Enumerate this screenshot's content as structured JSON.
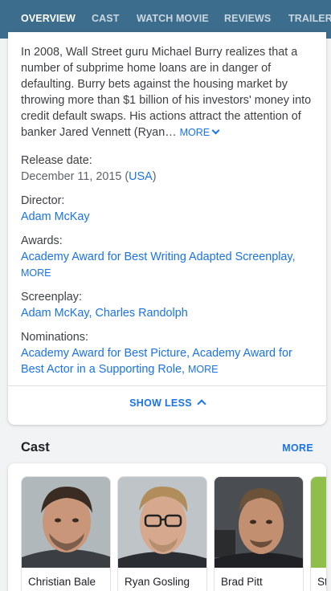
{
  "tabs": [
    {
      "label": "OVERVIEW",
      "active": true
    },
    {
      "label": "CAST",
      "active": false
    },
    {
      "label": "WATCH MOVIE",
      "active": false
    },
    {
      "label": "REVIEWS",
      "active": false
    },
    {
      "label": "TRAILERS",
      "active": false
    }
  ],
  "overview": {
    "description": "In 2008, Wall Street guru Michael Burry realizes that a number of subprime home loans are in danger of defaulting. Burry bets against the housing market by throwing more than $1 billion of his investors' money into credit default swaps. His actions attract the attention of banker Jared Vennett (Ryan…",
    "more_label": "MORE",
    "release_label": "Release date:",
    "release_date": "December 11, 2015",
    "release_country": "USA",
    "director_label": "Director:",
    "director": "Adam McKay",
    "awards_label": "Awards:",
    "awards": "Academy Award for Best Writing Adapted Screenplay",
    "awards_more": "MORE",
    "screenplay_label": "Screenplay:",
    "screenplay_1": "Adam McKay",
    "screenplay_2": "Charles Randolph",
    "nominations_label": "Nominations:",
    "nomination_1": "Academy Award for Best Picture",
    "nomination_2": "Academy Award for Best Actor in a Supporting Role",
    "nominations_more": "MORE",
    "show_less_label": "SHOW LESS"
  },
  "cast": {
    "title": "Cast",
    "more_label": "MORE",
    "actors": [
      {
        "name": "Christian Bale"
      },
      {
        "name": "Ryan Gosling"
      },
      {
        "name": "Brad Pitt"
      },
      {
        "name": "Steve Carell"
      }
    ]
  },
  "colors": {
    "tabbar": "#3d6d8c",
    "link": "#1a73e8",
    "background": "#f1f3f4"
  }
}
